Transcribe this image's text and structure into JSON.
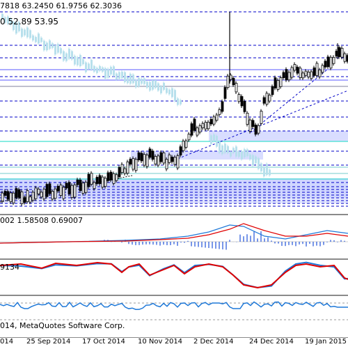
{
  "header": {
    "ohlc_label": "7818 63.2450 61.9756 62.3036",
    "indicator_values": "0 52.89 53.95"
  },
  "macd": {
    "values_label": "002 1.58508 0.69007"
  },
  "stochastic": {
    "value_label": "9134"
  },
  "footer": {
    "copyright": "014, MetaQuotes Software Corp."
  },
  "x_axis": {
    "labels": [
      "014",
      "25 Sep 2014",
      "17 Oct 2014",
      "10 Nov 2014",
      "2 Dec 2014",
      "24 Dec 2014",
      "19 Jan 2015"
    ]
  },
  "colors": {
    "bull": "#000000",
    "bear": "#b8e0ec",
    "level_line": "#0000c8",
    "zone": "#aab4ff",
    "teal": "#40e0d0",
    "macd_signal": "#e00000",
    "macd_hist": "#1e4fd8",
    "stoch_main": "#e00000",
    "stoch_signal": "#1e78d8",
    "rsi_line": "#1e78d8"
  },
  "chart_data": {
    "type": "candlestick",
    "series_note": "",
    "indicators": [
      "macd",
      "stochastic",
      "rsi"
    ]
  }
}
